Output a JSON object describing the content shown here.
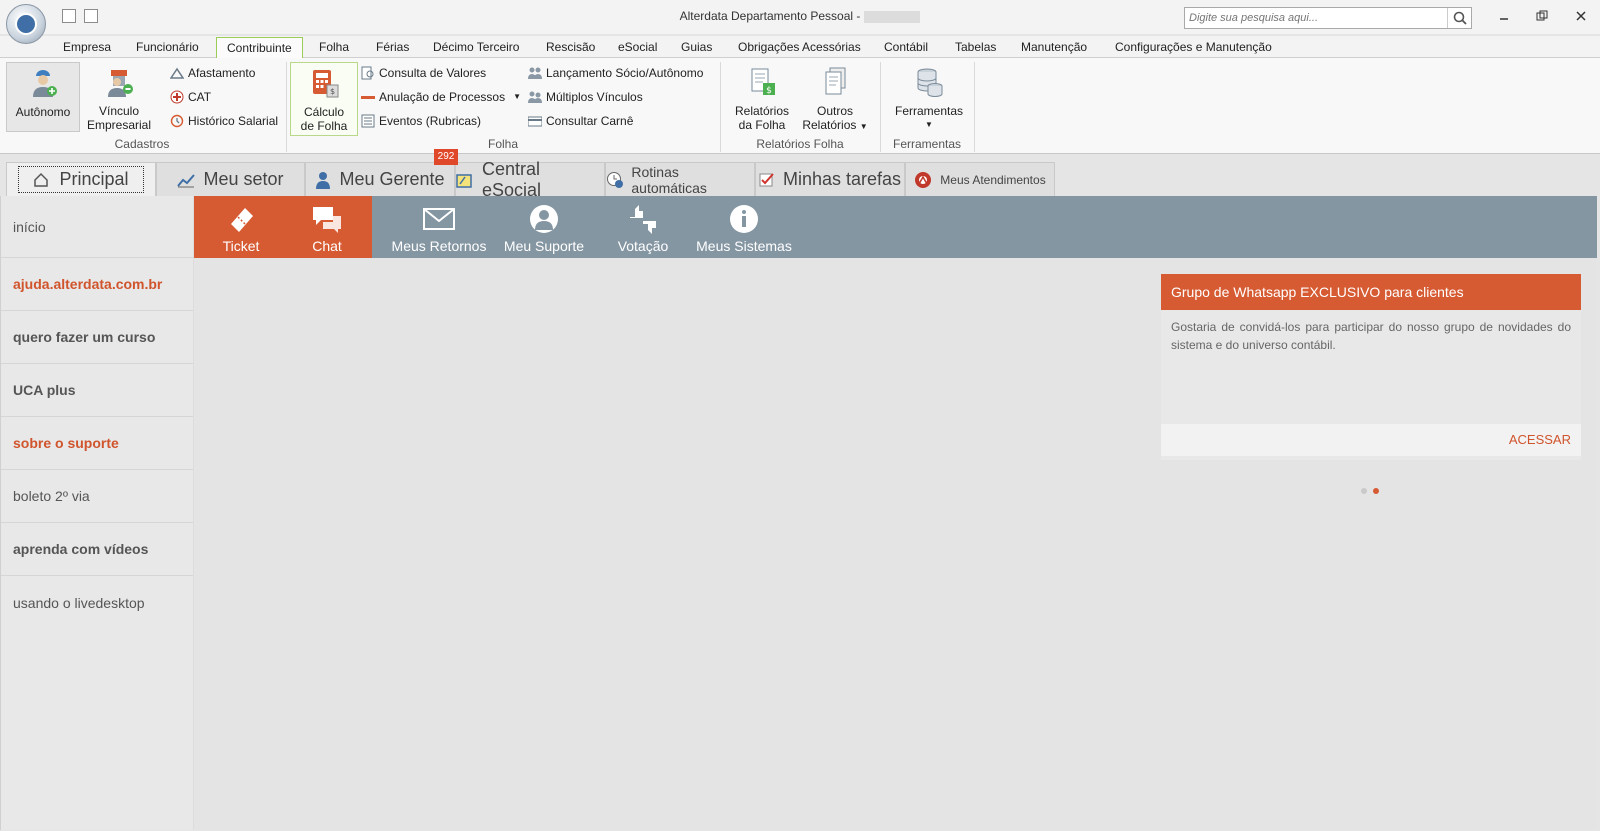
{
  "window": {
    "title": "Alterdata Departamento Pessoal -",
    "search_placeholder": "Digite sua pesquisa aqui..."
  },
  "menu": {
    "tabs": [
      "Empresa",
      "Funcionário",
      "Contribuinte",
      "Folha",
      "Férias",
      "Décimo Terceiro",
      "Rescisão",
      "eSocial",
      "Guias",
      "Obrigações Acessórias",
      "Contábil",
      "Tabelas",
      "Manutenção",
      "Configurações e Manutenção"
    ],
    "active": "Contribuinte"
  },
  "ribbon": {
    "cadastros": {
      "label": "Cadastros",
      "autonomo": "Autônomo",
      "vinculo_1": "Vínculo",
      "vinculo_2": "Empresarial",
      "afastamento": "Afastamento",
      "cat": "CAT",
      "historico": "Histórico Salarial"
    },
    "folha": {
      "label": "Folha",
      "calculo_1": "Cálculo",
      "calculo_2": "de Folha",
      "consulta": "Consulta de Valores",
      "anulacao": "Anulação de Processos",
      "eventos": "Eventos (Rubricas)",
      "lancamento": "Lançamento Sócio/Autônomo",
      "multiplos": "Múltiplos Vínculos",
      "carne": "Consultar Carnê"
    },
    "relatorios": {
      "label": "Relatórios Folha",
      "rel_1": "Relatórios",
      "rel_2": "da Folha",
      "outros_1": "Outros",
      "outros_2": "Relatórios"
    },
    "ferramentas": {
      "label": "Ferramentas",
      "btn": "Ferramentas"
    }
  },
  "home_tabs": {
    "principal": "Principal",
    "meu_setor": "Meu setor",
    "meu_gerente": "Meu Gerente",
    "badge": "292",
    "central_esocial": "Central eSocial",
    "rotinas": "Rotinas automáticas",
    "minhas_tarefas": "Minhas tarefas",
    "meus_atendimentos": "Meus Atendimentos"
  },
  "sidenav": {
    "inicio": "início",
    "ajuda": "ajuda.alterdata.com.br",
    "curso": "quero fazer um curso",
    "uca": "UCA plus",
    "suporte": "sobre o suporte",
    "boleto": "boleto 2º via",
    "videos": "aprenda com vídeos",
    "livedesktop": "usando o livedesktop"
  },
  "actions": {
    "ticket": "Ticket",
    "chat": "Chat",
    "retornos": "Meus Retornos",
    "suporte": "Meu Suporte",
    "votacao": "Votação",
    "sistemas": "Meus Sistemas"
  },
  "card": {
    "title": "Grupo de Whatsapp EXCLUSIVO para clientes",
    "body": "Gostaria de convidá-los para participar do nosso grupo de novidades do sistema e do universo contábil.",
    "cta": "ACESSAR"
  },
  "colors": {
    "accent": "#d65a32",
    "action_bar": "#8596a3",
    "active_tab_border": "#9acd57"
  }
}
